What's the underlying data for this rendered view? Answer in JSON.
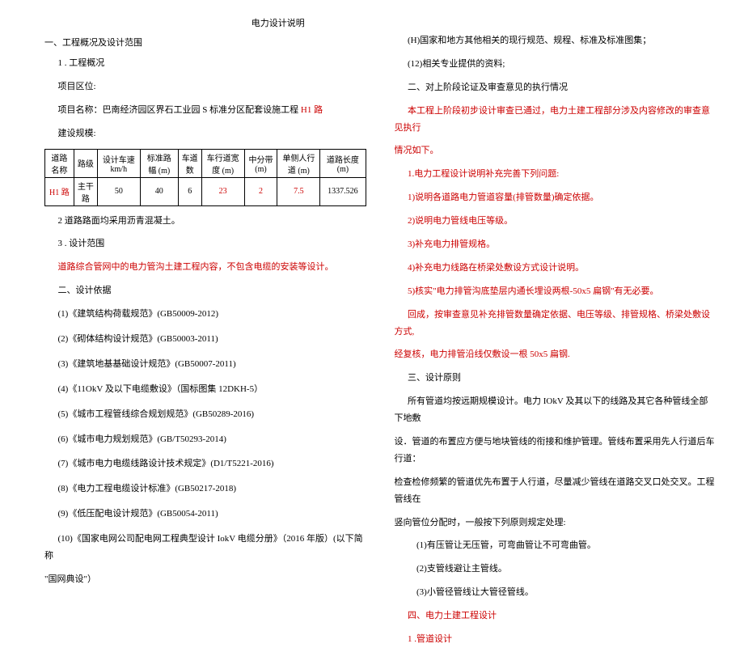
{
  "title": "电力设计说明",
  "left": {
    "h1": "一、工程概况及设计范围",
    "h1_1": "1 . 工程概况",
    "p_region": "项目区位:",
    "p_project": "项目名称：巴南经济园区界石工业园 S 标准分区配套设施工程",
    "p_project_link": "H1 路",
    "p_scale": "建设规模:",
    "table": {
      "headers": [
        "道路名称",
        "路级",
        "设计车速 km/h",
        "标准路幅 (m)",
        "车道数",
        "车行道宽度 (m)",
        "中分带 (m)",
        "单侧人行道 (m)",
        "道路长度 (m)"
      ],
      "row": {
        "name": "H1 路",
        "grade": "主干路",
        "speed": "50",
        "width": "40",
        "lanes": "6",
        "carriage": "23",
        "median": "2",
        "sidewalk": "7.5",
        "length": "1337.526"
      }
    },
    "p_pavement": "2    道路路面均采用沥青混凝土。",
    "h1_3": "3  . 设计范围",
    "p_scope": "道路综合管网中的电力管沟土建工程内容，不包含电缆的安装等设计。",
    "h2": "二、设计依据",
    "refs": [
      "(1)《建筑结构荷载规范》(GB50009-2012)",
      "(2)《砌体结构设计规范》(GB50003-2011)",
      "(3)《建筑地基基础设计规范》(GB50007-2011)",
      "(4)《11OkV 及以下电缆敷设》（国标图集 12DKH-5）",
      "(5)《城市工程管线综合规划规范》(GB50289-2016)",
      "(6)《城市电力规划规范》(GB/T50293-2014)",
      "(7)《城市电力电缆线路设计技术规定》(D1/T5221-2016)",
      "(8)《电力工程电缆设计标准》(GB50217-2018)",
      "(9)《低压配电设计规范》(GB50054-2011)"
    ],
    "ref10_a": "(10)《国家电网公司配电网工程典型设计 IokV 电缆分册》（2016 年版）(以下简称",
    "ref10_b": "\"国网典设\"）"
  },
  "right": {
    "p11": "(H)国家和地方其他相关的现行规范、规程、标准及标准图集；",
    "p12": "(12)相关专业提供的资料;",
    "p13": "二、对上阶段论证及审查意见的执行情况",
    "p_red1": "本工程上阶段初步设计审查已通过，电力土建工程部分涉及内容修改的审查意见执行",
    "p_red2": "情况如下。",
    "p_red_list": [
      "1.电力工程设计说明补充完善下列问题:",
      "1)说明各道路电力管道容量(排管数量)确定依据。",
      "2)说明电力管线电压等级。",
      "3)补充电力排管规格。",
      "4)补充电力线路在桥梁处敷设方式设计说明。",
      "5)核实\"电力排管沟底垫层内通长埋设两根-50x5 扁钢\"有无必要。"
    ],
    "p_red_sum1": "回成，按审查意见补充排管数量确定依据、电压等级、排管规格、桥梁处敷设方式,",
    "p_red_sum2": "经复核，电力排管沿线仅敷设一根 50x5 扁钢.",
    "h3": "三、设计原则",
    "p3_1": "所有管道均按远期规模设计。电力 IOkV 及其以下的线路及其它各种管线全部下地敷",
    "p3_2": "设．管道的布置应方便与地块管线的衔接和维护管理。管线布置采用先人行道后车行道：",
    "p3_3": "检查检修频繁的管道优先布置于人行道，尽量减少管线在道路交叉口处交叉。工程管线在",
    "p3_4": "竖向管位分配时，一般按下列原则规定处理:",
    "rules": [
      "(1)有压管让无压管，可弯曲管让不可弯曲管。",
      "(2)支管线避让主管线。",
      "(3)小管径管线让大管径管线。"
    ],
    "h4": "四、电力土建工程设计",
    "h4_1": "1  .管道设计"
  }
}
